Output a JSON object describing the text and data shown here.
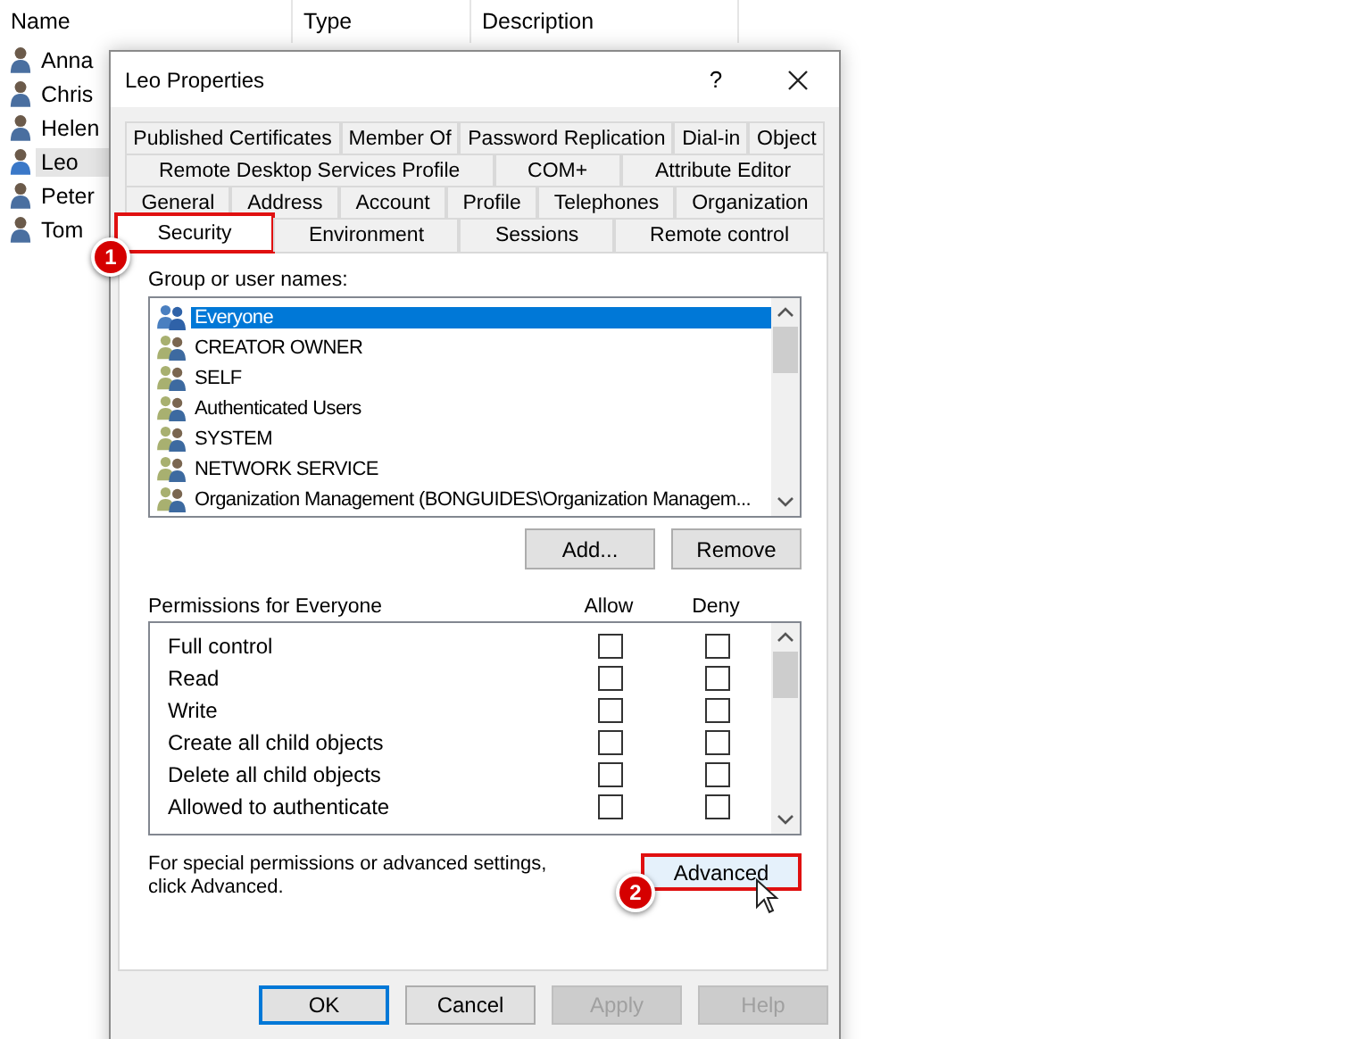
{
  "user_list": {
    "columns": [
      "Name",
      "Type",
      "Description"
    ],
    "rows": [
      {
        "name": "Anna",
        "selected": false
      },
      {
        "name": "Chris",
        "selected": false
      },
      {
        "name": "Helen",
        "selected": false
      },
      {
        "name": "Leo",
        "selected": true
      },
      {
        "name": "Peter",
        "selected": false
      },
      {
        "name": "Tom",
        "selected": false
      }
    ]
  },
  "dialog": {
    "title": "Leo Properties",
    "help": "?",
    "tab_rows": [
      [
        {
          "label": "Published Certificates",
          "selected": false
        },
        {
          "label": "Member Of",
          "selected": false
        },
        {
          "label": "Password Replication",
          "selected": false
        },
        {
          "label": "Dial-in",
          "selected": false
        },
        {
          "label": "Object",
          "selected": false
        }
      ],
      [
        {
          "label": "Remote Desktop Services Profile",
          "selected": false
        },
        {
          "label": "COM+",
          "selected": false
        },
        {
          "label": "Attribute Editor",
          "selected": false
        }
      ],
      [
        {
          "label": "General",
          "selected": false
        },
        {
          "label": "Address",
          "selected": false
        },
        {
          "label": "Account",
          "selected": false
        },
        {
          "label": "Profile",
          "selected": false
        },
        {
          "label": "Telephones",
          "selected": false
        },
        {
          "label": "Organization",
          "selected": false
        }
      ],
      [
        {
          "label": "Security",
          "selected": true,
          "callout": "1"
        },
        {
          "label": "Environment",
          "selected": false
        },
        {
          "label": "Sessions",
          "selected": false
        },
        {
          "label": "Remote control",
          "selected": false
        }
      ]
    ],
    "group_label": "Group or user names:",
    "principals": [
      {
        "name": "Everyone",
        "selected": true
      },
      {
        "name": "CREATOR OWNER",
        "selected": false
      },
      {
        "name": "SELF",
        "selected": false
      },
      {
        "name": "Authenticated Users",
        "selected": false
      },
      {
        "name": "SYSTEM",
        "selected": false
      },
      {
        "name": "NETWORK SERVICE",
        "selected": false
      },
      {
        "name": "Organization Management (BONGUIDES\\Organization Managem...",
        "selected": false
      }
    ],
    "principal_buttons": [
      "Add...",
      "Remove"
    ],
    "permissions_label": "Permissions for Everyone",
    "allow_label": "Allow",
    "deny_label": "Deny",
    "permissions": [
      {
        "name": "Full control",
        "allow": false,
        "deny": false
      },
      {
        "name": "Read",
        "allow": false,
        "deny": false
      },
      {
        "name": "Write",
        "allow": false,
        "deny": false
      },
      {
        "name": "Create all child objects",
        "allow": false,
        "deny": false
      },
      {
        "name": "Delete all child objects",
        "allow": false,
        "deny": false
      },
      {
        "name": "Allowed to authenticate",
        "allow": false,
        "deny": false
      }
    ],
    "advanced_note": "For special permissions or advanced settings, click Advanced.",
    "advanced_button": {
      "label": "Advanced",
      "callout": "2"
    },
    "buttons": [
      {
        "label": "OK",
        "disabled": false,
        "default": true
      },
      {
        "label": "Cancel",
        "disabled": false,
        "default": false
      },
      {
        "label": "Apply",
        "disabled": true,
        "default": false
      },
      {
        "label": "Help",
        "disabled": true,
        "default": false
      }
    ]
  }
}
